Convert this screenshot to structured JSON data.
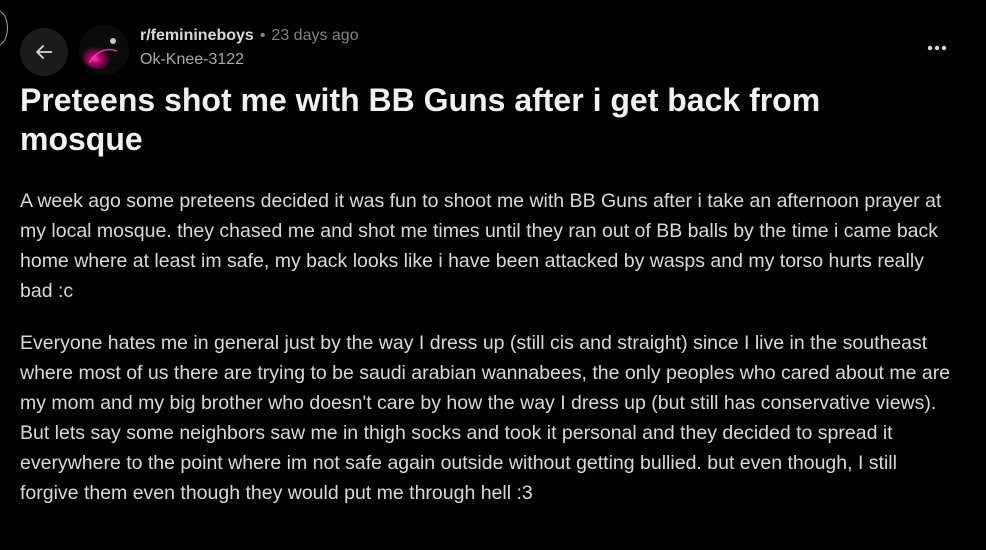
{
  "post": {
    "subreddit": "r/feminineboys",
    "separator": "•",
    "time_ago": "23 days ago",
    "author": "Ok-Knee-3122",
    "title": "Preteens shot me with BB Guns after i get back from mosque",
    "paragraphs": [
      "A week ago some preteens decided it was fun to shoot me with BB Guns after i take an afternoon prayer at my local mosque. they chased me and shot me times until they ran out of BB balls by the time i came back home where at least im safe, my back looks like i have been attacked by wasps and my torso hurts really bad :c",
      "Everyone hates me in general just by the way I dress up (still cis and straight) since I live in the southeast where most of us there are trying to be saudi arabian wannabees, the only peoples who cared about me are my mom and my big brother who doesn't care by how the way I dress up (but still has conservative views). But lets say some neighbors saw me in thigh socks and took it personal and they decided to spread it everywhere to the point where im not safe again outside without getting bullied. but even though, I still forgive them even though they would put me through hell :3"
    ]
  },
  "icons": {
    "back": "arrow-left-icon",
    "more": "ellipsis-icon",
    "avatar": "subreddit-avatar"
  },
  "colors": {
    "background": "#000000",
    "text": "#d7dadc",
    "title": "#f0f1f2",
    "muted": "#818384",
    "button_bg": "#1a1a1b",
    "avatar_accent": "#d6007a"
  }
}
